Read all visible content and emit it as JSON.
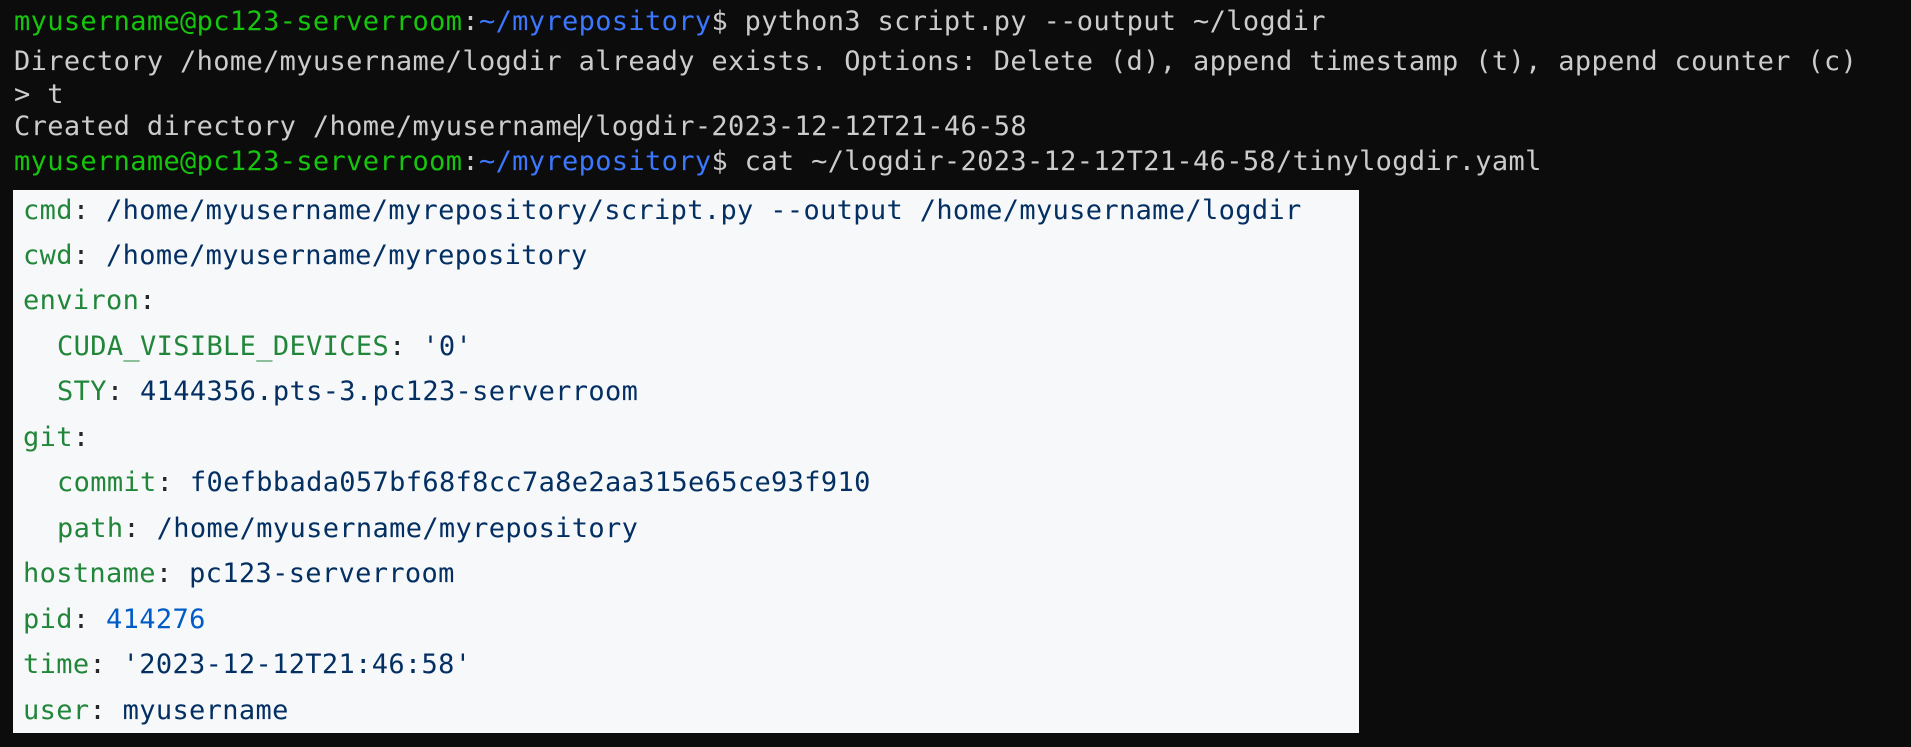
{
  "terminal": {
    "line1": {
      "user_host": "myusername@pc123-serverroom",
      "colon": ":",
      "path": "~/myrepository",
      "prompt_symbol": "$",
      "command": " python3 script.py --output ~/logdir"
    },
    "line2": "Directory /home/myusername/logdir already exists. Options: Delete (d), append timestamp (t), append counter (c)",
    "line3": "> t",
    "line4_before_cursor": "Created directory /home/myusername",
    "line4_after_cursor": "/logdir-2023-12-12T21-46-58",
    "line5": {
      "user_host": "myusername@pc123-serverroom",
      "colon": ":",
      "path": "~/myrepository",
      "prompt_symbol": "$",
      "command": " cat ~/logdir-2023-12-12T21-46-58/tinylogdir.yaml"
    }
  },
  "yaml": {
    "cmd": {
      "key": "cmd",
      "value": "/home/myusername/myrepository/script.py --output /home/myusername/logdir"
    },
    "cwd": {
      "key": "cwd",
      "value": "/home/myusername/myrepository"
    },
    "environ": {
      "key": "environ"
    },
    "cuda": {
      "key": "CUDA_VISIBLE_DEVICES",
      "value": "'0'"
    },
    "sty": {
      "key": "STY",
      "value": "4144356.pts-3.pc123-serverroom"
    },
    "git": {
      "key": "git"
    },
    "commit": {
      "key": "commit",
      "value": "f0efbbada057bf68f8cc7a8e2aa315e65ce93f910"
    },
    "path": {
      "key": "path",
      "value": "/home/myusername/myrepository"
    },
    "hostname": {
      "key": "hostname",
      "value": "pc123-serverroom"
    },
    "pid": {
      "key": "pid",
      "value": "414276"
    },
    "time": {
      "key": "time",
      "value": "'2023-12-12T21:46:58'"
    },
    "user": {
      "key": "user",
      "value": "myusername"
    }
  },
  "colors": {
    "terminal_bg": "#0c0c0c",
    "terminal_text": "#cccccc",
    "prompt_user": "#16c60c",
    "prompt_path": "#3b78ff",
    "yaml_bg": "#f6f8fa",
    "yaml_key": "#22863a",
    "yaml_string": "#032f62",
    "yaml_number": "#005cc5"
  }
}
